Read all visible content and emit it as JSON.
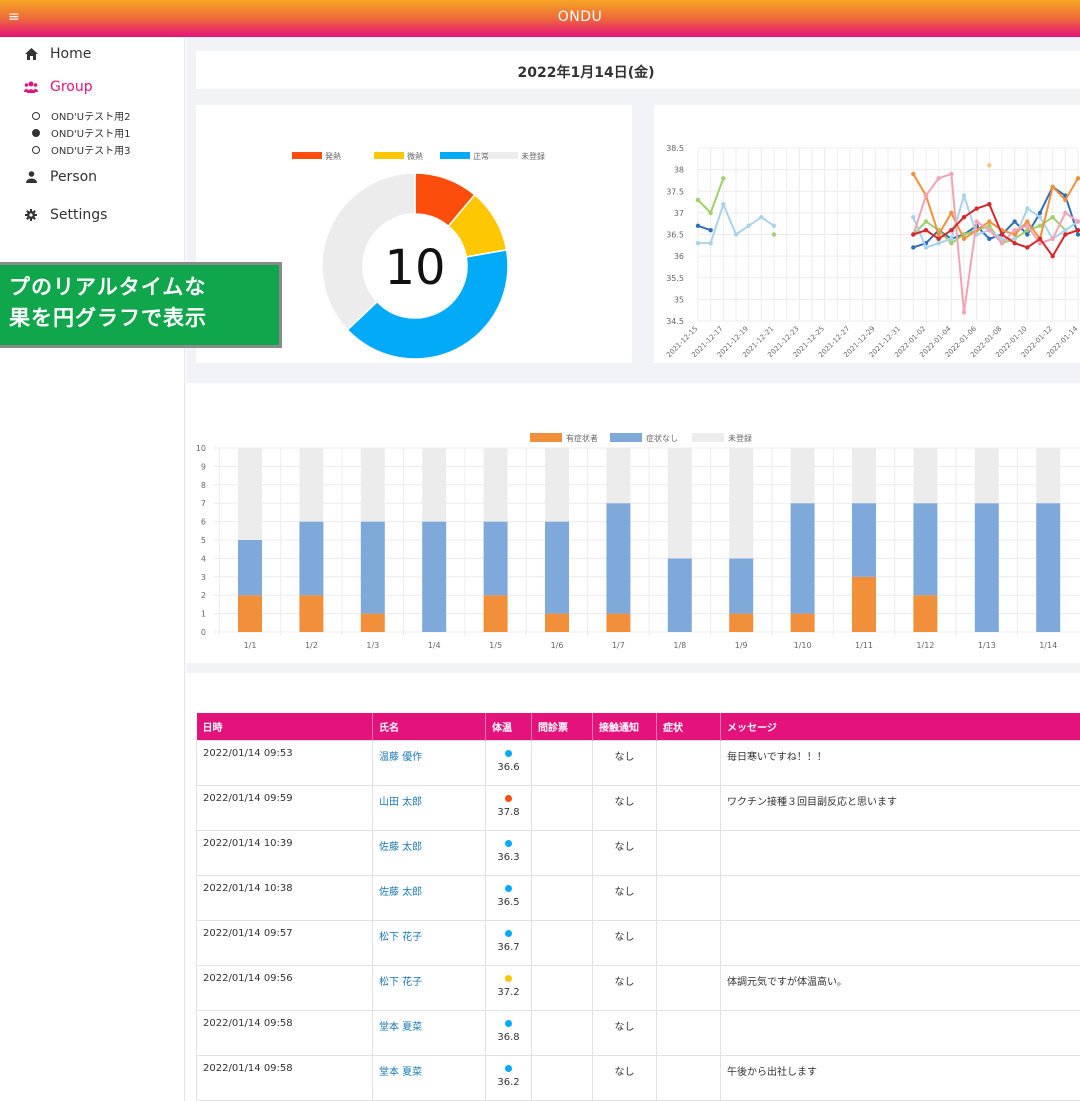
{
  "app": {
    "title": "ONDU",
    "menu_icon": "hamburger-icon"
  },
  "sidebar": {
    "items": [
      {
        "label": "Home",
        "icon": "home-icon"
      },
      {
        "label": "Group",
        "icon": "group-icon",
        "active": true
      },
      {
        "label": "Person",
        "icon": "person-icon"
      },
      {
        "label": "Settings",
        "icon": "gear-icon"
      }
    ],
    "groups": [
      {
        "label": "OND'Uテスト用2",
        "selected": false
      },
      {
        "label": "OND'Uテスト用1",
        "selected": true
      },
      {
        "label": "OND'Uテスト用3",
        "selected": false
      }
    ]
  },
  "overlay": {
    "line1": "プのリアルタイムな",
    "line2": "果を円グラフで表示"
  },
  "header": {
    "date": "2022年1月14日(金)"
  },
  "colors": {
    "accent": "#e4127b",
    "fever": "#fc4d0c",
    "slight_fever": "#fdc704",
    "normal": "#02aaf8",
    "unregistered": "#ececec",
    "symptom": "#f28f3b",
    "no_symptom": "#7fa9da"
  },
  "chart_data": [
    {
      "type": "pie",
      "legend": [
        "発熱",
        "微熱",
        "正常",
        "未登録"
      ],
      "legend_position": "top",
      "values": [
        3,
        3,
        11,
        10
      ],
      "center_label": "10"
    },
    {
      "type": "line",
      "x": [
        "2021-12-15",
        "2021-12-16",
        "2021-12-17",
        "2021-12-18",
        "2021-12-19",
        "2021-12-20",
        "2021-12-21",
        "2021-12-22",
        "2021-12-23",
        "2021-12-24",
        "2021-12-25",
        "2021-12-26",
        "2021-12-27",
        "2021-12-28",
        "2021-12-29",
        "2021-12-30",
        "2021-12-31",
        "2022-01-01",
        "2022-01-02",
        "2022-01-03",
        "2022-01-04",
        "2022-01-05",
        "2022-01-06",
        "2022-01-07",
        "2022-01-08",
        "2022-01-09",
        "2022-01-10",
        "2022-01-11",
        "2022-01-12",
        "2022-01-13",
        "2022-01-14"
      ],
      "x_tick_labels": [
        "2021-12-15",
        "2021-12-17",
        "2021-12-19",
        "2021-12-21",
        "2021-12-23",
        "2021-12-25",
        "2021-12-27",
        "2021-12-29",
        "2021-12-31",
        "2022-01-02",
        "2022-01-04",
        "2022-01-06",
        "2022-01-08",
        "2022-01-10",
        "2022-01-12",
        "2022-01-14"
      ],
      "ylim": [
        34.5,
        38.5
      ],
      "y_ticks": [
        "38.5",
        "38",
        "37.5",
        "37",
        "36.5",
        "36",
        "35.5",
        "35",
        "34.5"
      ],
      "grid": true,
      "series": [
        {
          "color": "#2e6fb5",
          "values": [
            36.7,
            36.6,
            null,
            null,
            null,
            null,
            null,
            null,
            null,
            null,
            null,
            null,
            null,
            null,
            null,
            null,
            null,
            36.2,
            36.3,
            36.6,
            36.4,
            36.5,
            36.7,
            36.4,
            36.5,
            36.8,
            36.5,
            37.0,
            37.6,
            37.4,
            36.5
          ]
        },
        {
          "color": "#9fd06b",
          "values": [
            37.3,
            37.0,
            37.8,
            null,
            null,
            null,
            36.5,
            null,
            null,
            null,
            null,
            null,
            null,
            null,
            null,
            null,
            null,
            36.5,
            36.8,
            36.6,
            36.3,
            36.5,
            36.6,
            36.7,
            36.3,
            36.4,
            36.6,
            36.7,
            36.9,
            36.6,
            36.8
          ]
        },
        {
          "color": "#a9d3ea",
          "values": [
            36.3,
            36.3,
            37.2,
            36.5,
            36.7,
            36.9,
            36.7,
            null,
            null,
            null,
            null,
            null,
            null,
            null,
            null,
            null,
            null,
            36.9,
            36.2,
            36.3,
            36.4,
            37.4,
            36.5,
            36.6,
            36.4,
            36.4,
            37.1,
            36.9,
            36.4,
            36.6,
            36.8
          ]
        },
        {
          "color": "#f28f3b",
          "values": [
            null,
            null,
            null,
            null,
            null,
            null,
            null,
            null,
            null,
            null,
            null,
            null,
            null,
            null,
            null,
            null,
            null,
            37.9,
            37.4,
            36.5,
            37.0,
            36.4,
            36.6,
            36.8,
            36.6,
            36.5,
            36.8,
            36.4,
            37.6,
            37.3,
            37.8
          ]
        },
        {
          "color": "#f3a3b5",
          "values": [
            null,
            null,
            null,
            null,
            null,
            null,
            null,
            null,
            null,
            null,
            null,
            null,
            null,
            null,
            null,
            null,
            null,
            36.5,
            37.4,
            37.8,
            37.9,
            34.7,
            36.8,
            36.6,
            36.3,
            36.6,
            36.7,
            36.3,
            36.4,
            37.0,
            36.8
          ]
        },
        {
          "color": "#d6272a",
          "values": [
            null,
            null,
            null,
            null,
            null,
            null,
            null,
            null,
            null,
            null,
            null,
            null,
            null,
            null,
            null,
            null,
            null,
            36.5,
            36.6,
            36.4,
            36.6,
            36.9,
            37.1,
            37.2,
            36.5,
            36.3,
            36.2,
            36.4,
            36.0,
            36.5,
            36.6
          ]
        },
        {
          "color": "#ffc27a",
          "values": [
            null,
            null,
            null,
            null,
            null,
            null,
            null,
            null,
            null,
            null,
            null,
            null,
            null,
            null,
            null,
            null,
            null,
            null,
            null,
            null,
            null,
            null,
            null,
            38.1,
            null,
            null,
            null,
            null,
            null,
            null,
            null
          ]
        }
      ]
    },
    {
      "type": "bar",
      "stacked": true,
      "legend": [
        "有症状者",
        "症状なし",
        "未登録"
      ],
      "legend_position": "top",
      "categories": [
        "1/1",
        "1/2",
        "1/3",
        "1/4",
        "1/5",
        "1/6",
        "1/7",
        "1/8",
        "1/9",
        "1/10",
        "1/11",
        "1/12",
        "1/13",
        "1/14"
      ],
      "ylim": [
        0,
        10
      ],
      "y_ticks": [
        "0",
        "1",
        "2",
        "3",
        "4",
        "5",
        "6",
        "7",
        "8",
        "9",
        "10"
      ],
      "series": [
        {
          "name": "有症状者",
          "values": [
            2,
            2,
            1,
            0,
            2,
            1,
            1,
            0,
            1,
            1,
            3,
            2,
            0,
            0
          ]
        },
        {
          "name": "症状なし",
          "values": [
            3,
            4,
            5,
            6,
            4,
            5,
            6,
            4,
            3,
            6,
            4,
            5,
            7,
            7
          ]
        },
        {
          "name": "未登録",
          "values": [
            5,
            4,
            4,
            4,
            4,
            4,
            3,
            6,
            6,
            3,
            3,
            3,
            3,
            3
          ]
        }
      ]
    }
  ],
  "table": {
    "headers": [
      "日時",
      "氏名",
      "体温",
      "問診票",
      "接触通知",
      "症状",
      "メッセージ"
    ],
    "rows": [
      {
        "datetime": "2022/01/14 09:53",
        "name": "温藤 優作",
        "temp": "36.6",
        "temp_color": "#02aaf8",
        "questionnaire": "",
        "contact": "なし",
        "symptom": "",
        "message": "毎日寒いですね！！！"
      },
      {
        "datetime": "2022/01/14 09:59",
        "name": "山田 太郎",
        "temp": "37.8",
        "temp_color": "#fc4d0c",
        "questionnaire": "",
        "contact": "なし",
        "symptom": "",
        "message": "ワクチン接種３回目副反応と思います"
      },
      {
        "datetime": "2022/01/14 10:39",
        "name": "佐藤 太郎",
        "temp": "36.3",
        "temp_color": "#02aaf8",
        "questionnaire": "",
        "contact": "なし",
        "symptom": "",
        "message": ""
      },
      {
        "datetime": "2022/01/14 10:38",
        "name": "佐藤 太郎",
        "temp": "36.5",
        "temp_color": "#02aaf8",
        "questionnaire": "",
        "contact": "なし",
        "symptom": "",
        "message": ""
      },
      {
        "datetime": "2022/01/14 09:57",
        "name": "松下 花子",
        "temp": "36.7",
        "temp_color": "#02aaf8",
        "questionnaire": "",
        "contact": "なし",
        "symptom": "",
        "message": ""
      },
      {
        "datetime": "2022/01/14 09:56",
        "name": "松下 花子",
        "temp": "37.2",
        "temp_color": "#fdc704",
        "questionnaire": "",
        "contact": "なし",
        "symptom": "",
        "message": "体調元気ですが体温高い。"
      },
      {
        "datetime": "2022/01/14 09:58",
        "name": "堂本 夏菜",
        "temp": "36.8",
        "temp_color": "#02aaf8",
        "questionnaire": "",
        "contact": "なし",
        "symptom": "",
        "message": ""
      },
      {
        "datetime": "2022/01/14 09:58",
        "name": "堂本 夏菜",
        "temp": "36.2",
        "temp_color": "#02aaf8",
        "questionnaire": "",
        "contact": "なし",
        "symptom": "",
        "message": "午後から出社します"
      }
    ]
  }
}
